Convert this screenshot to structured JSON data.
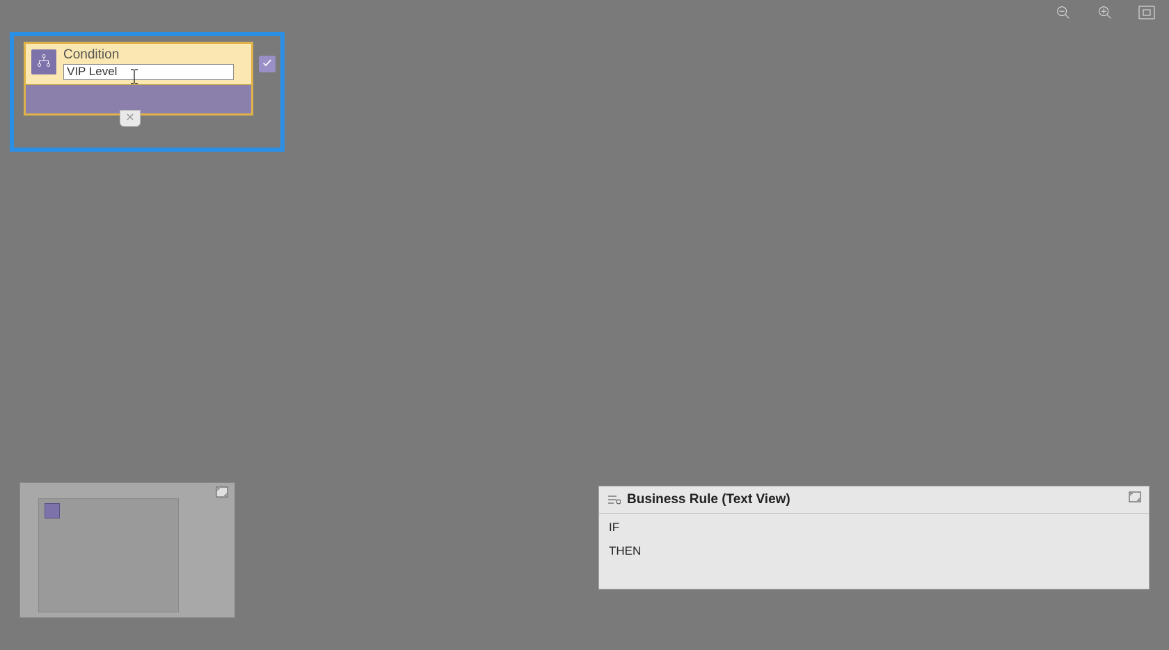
{
  "toolbar": {
    "zoom_out_icon": "zoom-out",
    "zoom_in_icon": "zoom-in",
    "fit_icon": "fit-screen"
  },
  "condition_node": {
    "label": "Condition",
    "name_value": "VIP Level",
    "checkmark_icon": "check",
    "icon": "hierarchy",
    "close_icon": "close"
  },
  "minimap": {
    "expand_icon": "expand"
  },
  "text_view": {
    "title": "Business Rule (Text View)",
    "icon": "rule",
    "expand_icon": "expand",
    "lines": {
      "if": "IF",
      "then": "THEN"
    }
  }
}
